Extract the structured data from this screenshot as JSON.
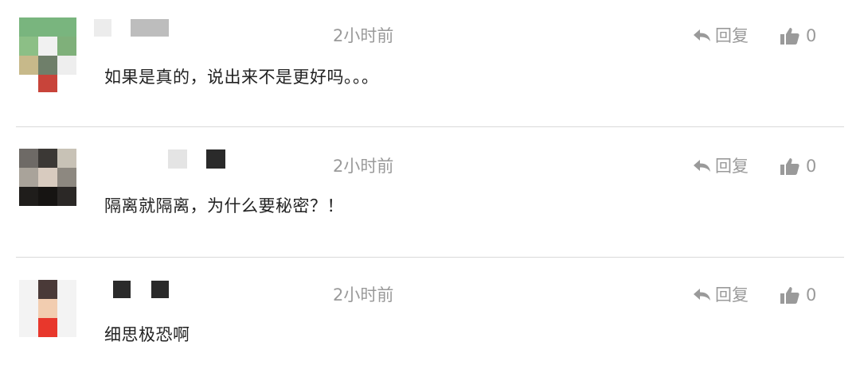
{
  "comments": [
    {
      "time": "2小时前",
      "reply_label": "回复",
      "likes": "0",
      "text": "如果是真的，说出来不是更好吗。。。"
    },
    {
      "time": "2小时前",
      "reply_label": "回复",
      "likes": "0",
      "text": "隔离就隔离，为什么要秘密？！"
    },
    {
      "time": "2小时前",
      "reply_label": "回复",
      "likes": "0",
      "text": "细思极恐啊"
    }
  ],
  "icons": {
    "reply": "reply-arrow-icon",
    "like": "thumbs-up-icon"
  },
  "colors": {
    "meta_text": "#9a9a9a",
    "body_text": "#222222",
    "divider": "#d9d9d9"
  }
}
